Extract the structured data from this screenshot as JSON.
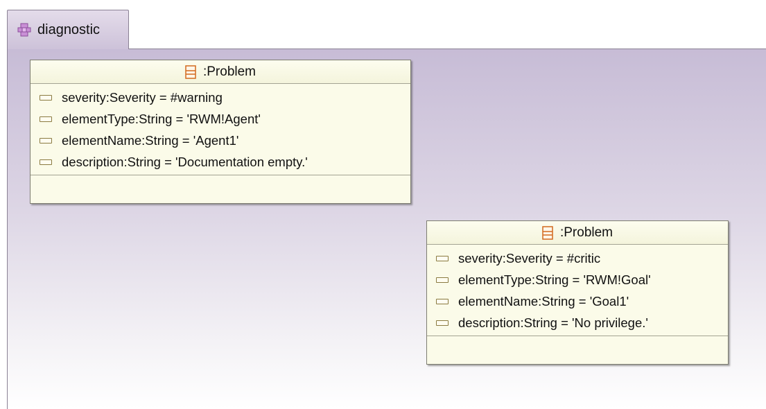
{
  "tab": {
    "label": "diagnostic",
    "icon": "diagram-icon"
  },
  "colors": {
    "accent": "#cdc2d9",
    "node_fill": "#fbfbe9",
    "attr_icon": "#8a7a40"
  },
  "nodes": [
    {
      "title": ":Problem",
      "attributes": [
        "severity:Severity = #warning",
        "elementType:String = 'RWM!Agent'",
        "elementName:String = 'Agent1'",
        "description:String = 'Documentation empty.'"
      ]
    },
    {
      "title": ":Problem",
      "attributes": [
        "severity:Severity = #critic",
        "elementType:String = 'RWM!Goal'",
        "elementName:String = 'Goal1'",
        "description:String = 'No privilege.'"
      ]
    }
  ]
}
